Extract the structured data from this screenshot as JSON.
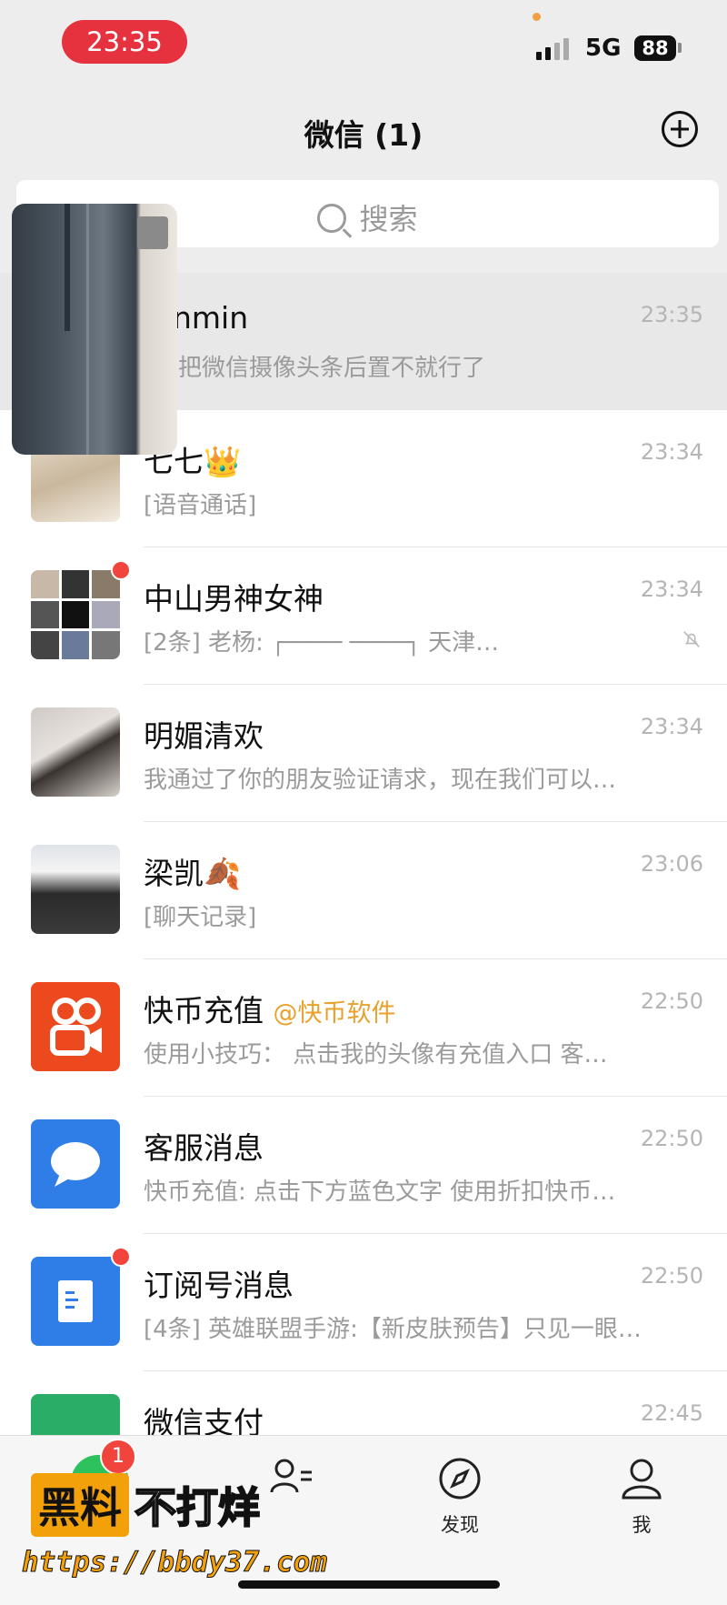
{
  "status_bar": {
    "time": "23:35",
    "network": "5G",
    "battery": "88"
  },
  "header": {
    "title": "微信 (1)"
  },
  "search": {
    "placeholder": "搜索"
  },
  "chats": [
    {
      "name": "nmin",
      "preview": "把微信摄像头条后置不就行了",
      "time": "23:35"
    },
    {
      "name": "七七👑",
      "preview": "[语音通话]",
      "time": "23:34"
    },
    {
      "name": "中山男神女神",
      "preview": "[2条] 老杨: ┌──── ────┐ 天津…",
      "time": "23:34",
      "unread_dot": true,
      "muted": true
    },
    {
      "name": "明媚清欢",
      "preview": "我通过了你的朋友验证请求，现在我们可以…",
      "time": "23:34"
    },
    {
      "name": "梁凯🍂",
      "preview": "[聊天记录]",
      "time": "23:06"
    },
    {
      "name": "快币充值",
      "mention": "@快币软件",
      "preview": "使用小技巧：  点击我的头像有充值入口 客…",
      "time": "22:50"
    },
    {
      "name": "客服消息",
      "preview": "快币充值: 点击下方蓝色文字  使用折扣快币…",
      "time": "22:50"
    },
    {
      "name": "订阅号消息",
      "preview": "[4条] 英雄联盟手游:【新皮肤预告】只见一眼…",
      "time": "22:50",
      "unread_dot": true
    },
    {
      "name": "微信支付",
      "preview": "",
      "time": "22:45"
    }
  ],
  "tabbar": {
    "chats_badge": "1",
    "tabs": [
      {
        "label": "发现",
        "icon": "compass-icon"
      },
      {
        "label": "我",
        "icon": "person-icon"
      }
    ]
  },
  "watermark": {
    "box": "黑料",
    "text": "不打烊",
    "url": "https://bbdy37.com"
  }
}
